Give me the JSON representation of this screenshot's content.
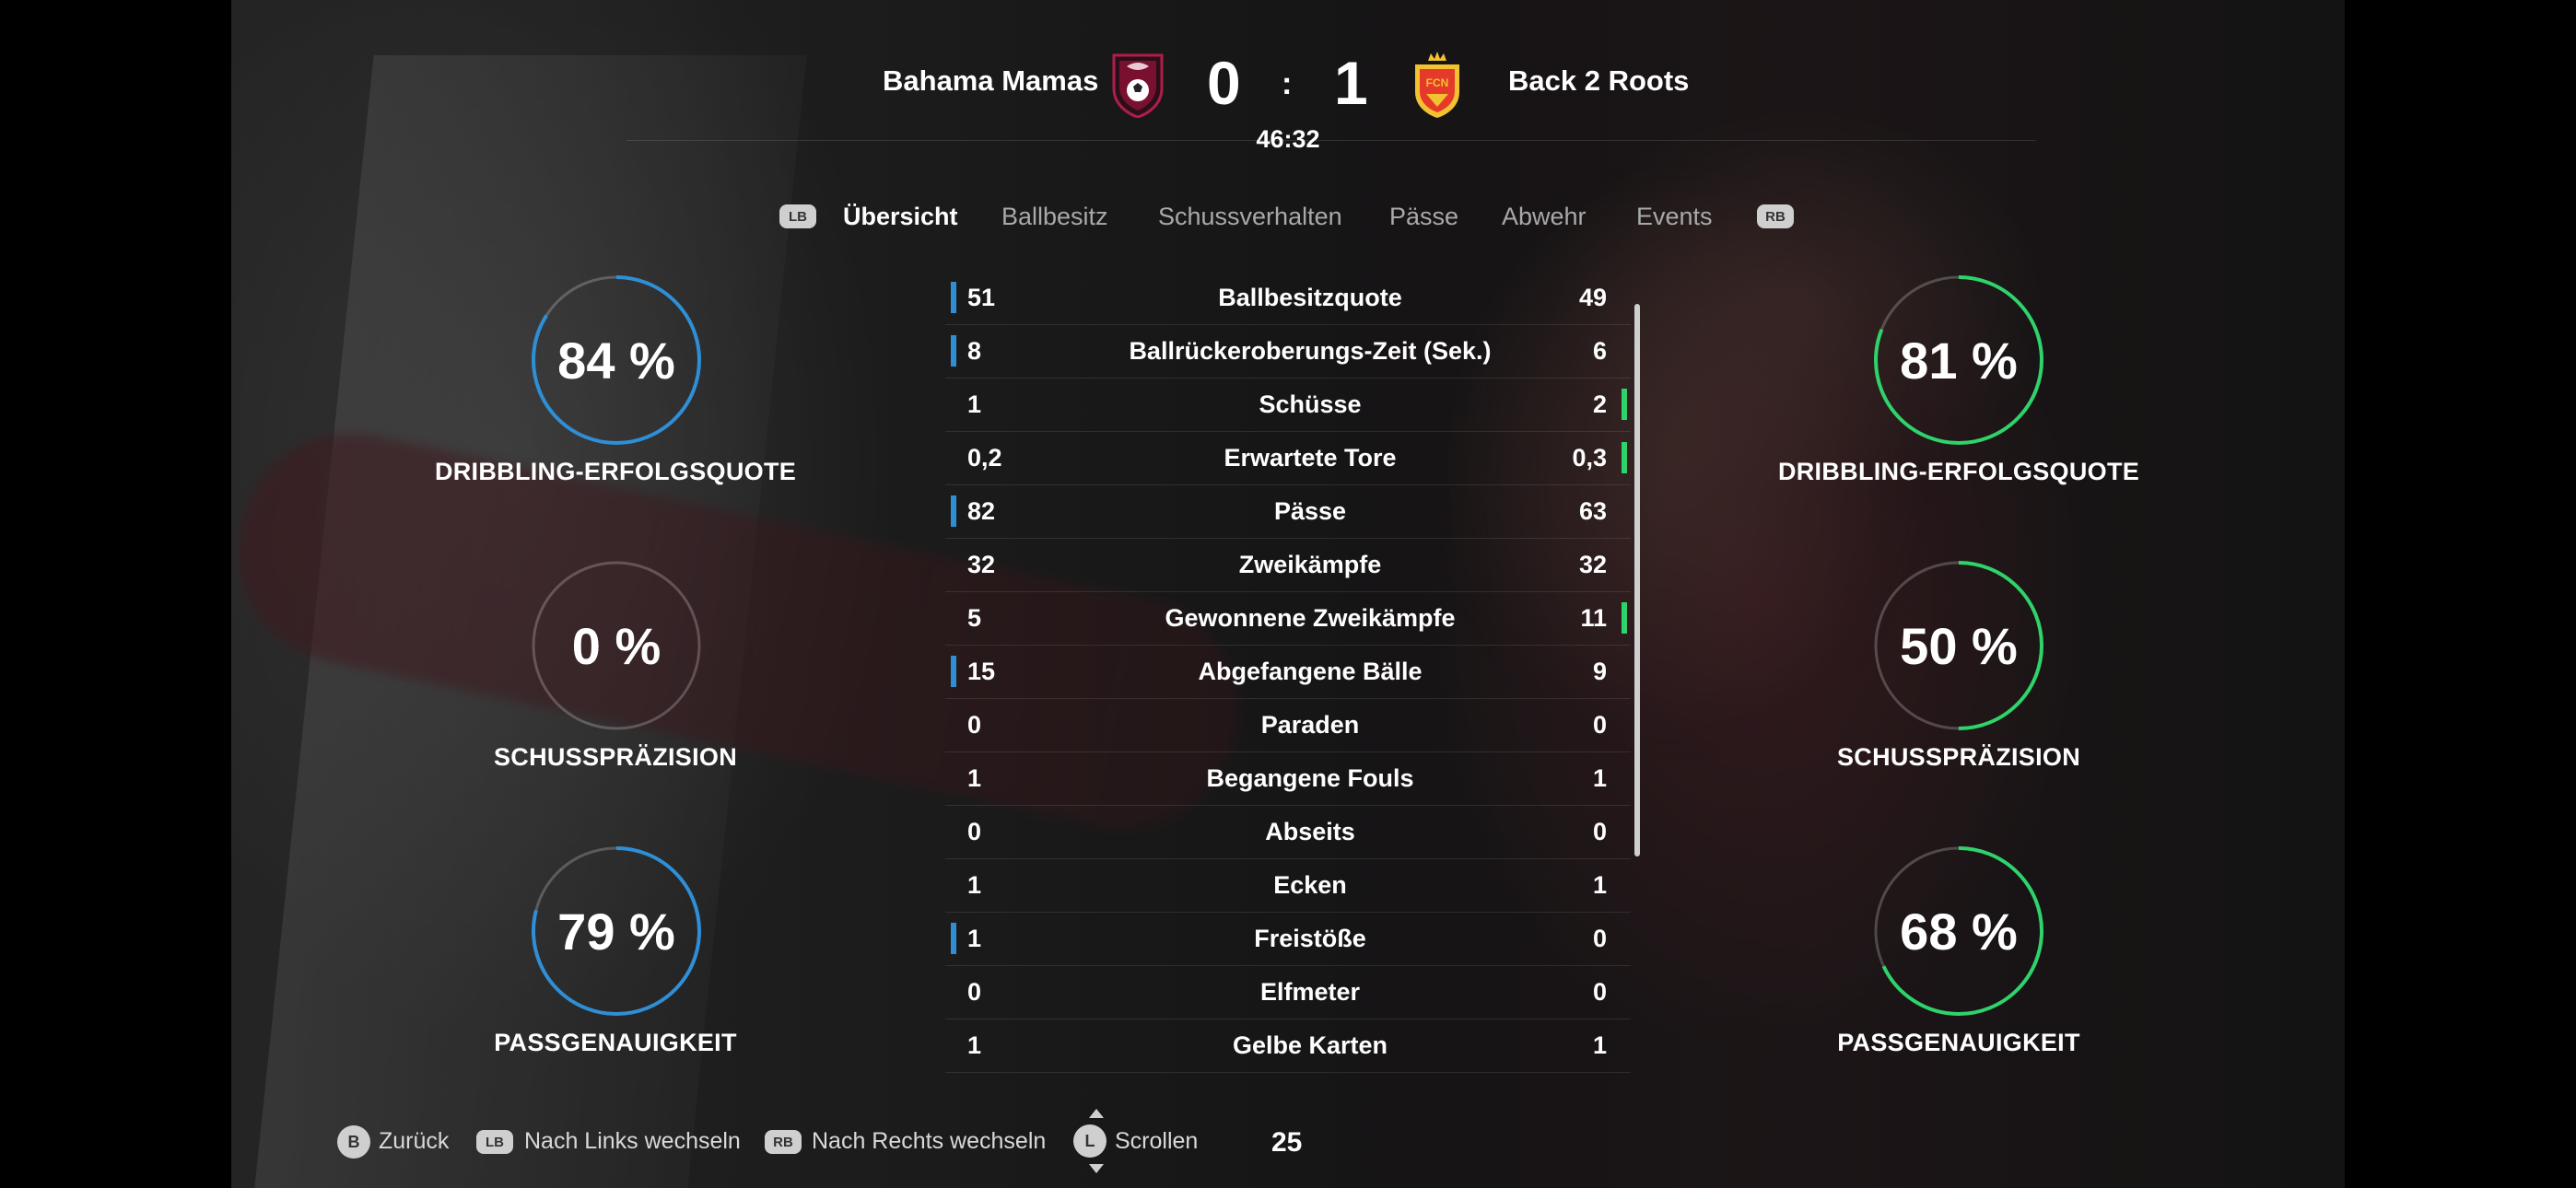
{
  "header": {
    "home_team": "Bahama Mamas",
    "away_team": "Back 2 Roots",
    "home_score": "0",
    "score_separator": ":",
    "away_score": "1",
    "match_time": "46:32",
    "colors": {
      "home_crest": "#7a1030",
      "away_crest": "#e53a2a"
    }
  },
  "tabs": {
    "left_shoulder": "LB",
    "right_shoulder": "RB",
    "items": [
      "Übersicht",
      "Ballbesitz",
      "Schussverhalten",
      "Pässe",
      "Abwehr",
      "Events"
    ],
    "active_index": 0
  },
  "left_gauges": [
    {
      "value": "84 %",
      "label": "DRIBBLING-ERFOLGSQUOTE",
      "percent": 84,
      "color": "#2f8fd6"
    },
    {
      "value": "0 %",
      "label": "SCHUSSPRÄZISION",
      "percent": 0,
      "color": "#2f8fd6"
    },
    {
      "value": "79 %",
      "label": "PASSGENAUIGKEIT",
      "percent": 79,
      "color": "#2f8fd6"
    }
  ],
  "right_gauges": [
    {
      "value": "81 %",
      "label": "DRIBBLING-ERFOLGSQUOTE",
      "percent": 81,
      "color": "#2fd36b"
    },
    {
      "value": "50 %",
      "label": "SCHUSSPRÄZISION",
      "percent": 50,
      "color": "#2fd36b"
    },
    {
      "value": "68 %",
      "label": "PASSGENAUIGKEIT",
      "percent": 68,
      "color": "#2fd36b"
    }
  ],
  "stats": [
    {
      "home": "51",
      "name": "Ballbesitzquote",
      "away": "49",
      "lead": "home"
    },
    {
      "home": "8",
      "name": "Ballrückeroberungs-Zeit (Sek.)",
      "away": "6",
      "lead": "home"
    },
    {
      "home": "1",
      "name": "Schüsse",
      "away": "2",
      "lead": "away"
    },
    {
      "home": "0,2",
      "name": "Erwartete Tore",
      "away": "0,3",
      "lead": "away"
    },
    {
      "home": "82",
      "name": "Pässe",
      "away": "63",
      "lead": "home"
    },
    {
      "home": "32",
      "name": "Zweikämpfe",
      "away": "32",
      "lead": "none"
    },
    {
      "home": "5",
      "name": "Gewonnene Zweikämpfe",
      "away": "11",
      "lead": "away"
    },
    {
      "home": "15",
      "name": "Abgefangene Bälle",
      "away": "9",
      "lead": "home"
    },
    {
      "home": "0",
      "name": "Paraden",
      "away": "0",
      "lead": "none"
    },
    {
      "home": "1",
      "name": "Begangene Fouls",
      "away": "1",
      "lead": "none"
    },
    {
      "home": "0",
      "name": "Abseits",
      "away": "0",
      "lead": "none"
    },
    {
      "home": "1",
      "name": "Ecken",
      "away": "1",
      "lead": "none"
    },
    {
      "home": "1",
      "name": "Freistöße",
      "away": "0",
      "lead": "home"
    },
    {
      "home": "0",
      "name": "Elfmeter",
      "away": "0",
      "lead": "none"
    },
    {
      "home": "1",
      "name": "Gelbe Karten",
      "away": "1",
      "lead": "none"
    }
  ],
  "footer": {
    "back_button": "B",
    "back_label": "Zurück",
    "left_button": "LB",
    "left_label": "Nach Links wechseln",
    "right_button": "RB",
    "right_label": "Nach Rechts wechseln",
    "scroll_button": "L",
    "scroll_label": "Scrollen",
    "counter": "25"
  }
}
